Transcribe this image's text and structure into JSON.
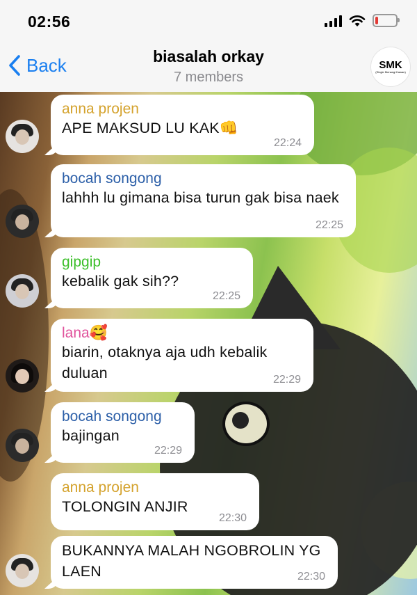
{
  "status_bar": {
    "time": "02:56",
    "battery_level": 0.12,
    "icons": [
      "signal-icon",
      "wifi-icon",
      "battery-icon"
    ]
  },
  "nav": {
    "back_label": "Back",
    "title": "biasalah orkay",
    "subtitle": "7 members",
    "avatar_text": "SMK",
    "avatar_subtext": "(Single Menangi Kawan)"
  },
  "colors": {
    "accent": "#1a7ff0",
    "anna": "#d4a22c",
    "bocah": "#2c5fa8",
    "gipgip": "#3cbf2a",
    "lana": "#e0529c"
  },
  "messages": [
    {
      "sender": "anna projen",
      "text": "APE MAKSUD LU KAK👊",
      "time": "22:24"
    },
    {
      "sender": "bocah songong",
      "text": "lahhh lu gimana bisa turun gak bisa naek",
      "time": "22:25"
    },
    {
      "sender": "gipgip",
      "text": "kebalik gak sih??",
      "time": "22:25"
    },
    {
      "sender": "lana🥰",
      "text": "biarin, otaknya aja udh kebalik duluan",
      "time": "22:29"
    },
    {
      "sender": "bocah songong",
      "text": "bajingan",
      "time": "22:29"
    },
    {
      "sender": "anna projen",
      "text": "TOLONGIN ANJIR",
      "time": "22:30"
    },
    {
      "sender": "",
      "text": "BUKANNYA MALAH NGOBROLIN YG LAEN",
      "time": "22:30"
    }
  ]
}
